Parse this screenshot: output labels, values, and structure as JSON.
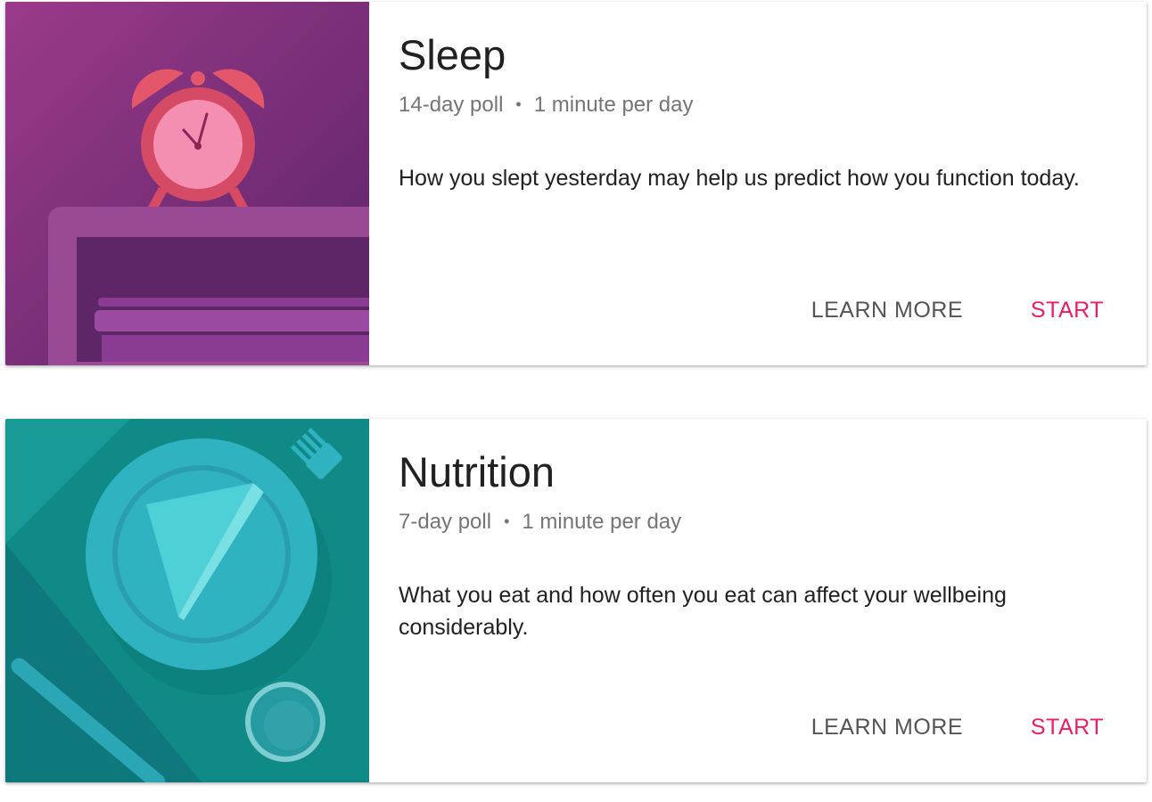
{
  "cards": [
    {
      "title": "Sleep",
      "duration": "14-day poll",
      "separator": "•",
      "time": "1 minute per day",
      "description": "How you slept yesterday may help us predict how you function today.",
      "learn_more_label": "LEARN MORE",
      "start_label": "START",
      "illustration": "alarm-clock-on-nightstand"
    },
    {
      "title": "Nutrition",
      "duration": "7-day poll",
      "separator": "•",
      "time": "1 minute per day",
      "description": "What you eat and how often you eat can affect your wellbeing considerably.",
      "learn_more_label": "LEARN MORE",
      "start_label": "START",
      "illustration": "plate-with-food-and-cutlery"
    }
  ],
  "colors": {
    "accent": "#e91e63",
    "secondary_button": "#545454",
    "sleep_bg": "#7d2e7e",
    "nutrition_bg": "#0f8a86"
  }
}
